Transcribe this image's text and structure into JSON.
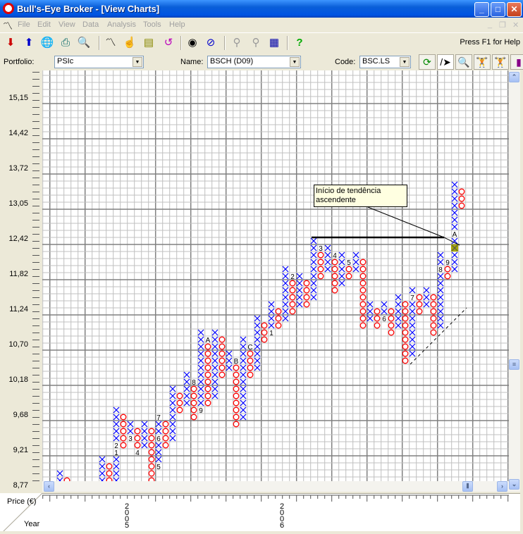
{
  "window": {
    "title": "Bull's-Eye Broker - [View Charts]"
  },
  "menu": [
    "File",
    "Edit",
    "View",
    "Data",
    "Analysis",
    "Tools",
    "Help"
  ],
  "toolbar": {
    "help_text": "Press F1 for Help",
    "icons": [
      "import-icon",
      "export-icon",
      "internet-icon",
      "print-icon",
      "print-preview-icon",
      "chart-icon",
      "pointer-hand-icon",
      "folder-icon",
      "undo-icon",
      "eye-icon",
      "no-icon",
      "zoom-out-icon",
      "zoom-fit-icon",
      "grid-icon",
      "help-icon"
    ]
  },
  "selectors": {
    "portfolio_label": "Portfolio:",
    "portfolio_value": "PSIc",
    "name_label": "Name:",
    "name_value": "BSCH (D09)",
    "code_label": "Code:",
    "code_value": "BSC.LS"
  },
  "annotation": {
    "line1": "Início de tendência",
    "line2": "ascendente"
  },
  "chart_data": {
    "type": "point-and-figure",
    "ylabel": "Price (€)",
    "xlabel": "Year",
    "y_ticks": [
      "15,15",
      "14,42",
      "13,72",
      "13,05",
      "12,42",
      "11,82",
      "11,24",
      "10,70",
      "10,18",
      "9,68",
      "9,21",
      "8,77"
    ],
    "years": [
      "2005",
      "2006"
    ],
    "note": "rows are box indices (5 boxes per labelled tick, 8,77 at box 0)",
    "columns": [
      {
        "col": 2,
        "type": "X",
        "lo": 0,
        "hi": 2
      },
      {
        "col": 3,
        "type": "O",
        "lo": 0,
        "hi": 1
      },
      {
        "col": 8,
        "type": "X",
        "lo": 0,
        "hi": 4
      },
      {
        "col": 9,
        "type": "O",
        "lo": 0,
        "hi": 3
      },
      {
        "col": 10,
        "type": "X",
        "lo": 0,
        "hi": 11,
        "labels": {
          "5": "1",
          "6": "2"
        }
      },
      {
        "col": 11,
        "type": "O",
        "lo": 6,
        "hi": 10
      },
      {
        "col": 12,
        "type": "X",
        "lo": 7,
        "hi": 9,
        "labels": {
          "7": "3"
        }
      },
      {
        "col": 13,
        "type": "O",
        "lo": 5,
        "hi": 8,
        "labels": {
          "5": "4"
        }
      },
      {
        "col": 14,
        "type": "X",
        "lo": 6,
        "hi": 9
      },
      {
        "col": 15,
        "type": "O",
        "lo": 0,
        "hi": 8
      },
      {
        "col": 16,
        "type": "X",
        "lo": 3,
        "hi": 10,
        "labels": {
          "3": "5",
          "7": "6",
          "10": "7"
        }
      },
      {
        "col": 17,
        "type": "O",
        "lo": 6,
        "hi": 9
      },
      {
        "col": 18,
        "type": "X",
        "lo": 7,
        "hi": 14
      },
      {
        "col": 19,
        "type": "O",
        "lo": 11,
        "hi": 13
      },
      {
        "col": 20,
        "type": "X",
        "lo": 12,
        "hi": 16
      },
      {
        "col": 21,
        "type": "O",
        "lo": 10,
        "hi": 15,
        "labels": {
          "15": "8"
        }
      },
      {
        "col": 22,
        "type": "X",
        "lo": 11,
        "hi": 22,
        "labels": {
          "11": "9"
        }
      },
      {
        "col": 23,
        "type": "O",
        "lo": 12,
        "hi": 21,
        "labels": {
          "21": "A"
        }
      },
      {
        "col": 24,
        "type": "X",
        "lo": 13,
        "hi": 22
      },
      {
        "col": 25,
        "type": "O",
        "lo": 16,
        "hi": 21
      },
      {
        "col": 26,
        "type": "X",
        "lo": 17,
        "hi": 19
      },
      {
        "col": 27,
        "type": "O",
        "lo": 9,
        "hi": 18,
        "labels": {
          "18": "B"
        }
      },
      {
        "col": 28,
        "type": "X",
        "lo": 10,
        "hi": 21
      },
      {
        "col": 29,
        "type": "O",
        "lo": 16,
        "hi": 20,
        "labels": {
          "20": "C"
        }
      },
      {
        "col": 30,
        "type": "X",
        "lo": 17,
        "hi": 24
      },
      {
        "col": 31,
        "type": "O",
        "lo": 21,
        "hi": 23
      },
      {
        "col": 32,
        "type": "X",
        "lo": 22,
        "hi": 26,
        "labels": {
          "22": "1"
        }
      },
      {
        "col": 33,
        "type": "O",
        "lo": 23,
        "hi": 25
      },
      {
        "col": 34,
        "type": "X",
        "lo": 24,
        "hi": 31
      },
      {
        "col": 35,
        "type": "O",
        "lo": 25,
        "hi": 30,
        "labels": {
          "30": "2"
        }
      },
      {
        "col": 36,
        "type": "X",
        "lo": 26,
        "hi": 30
      },
      {
        "col": 37,
        "type": "O",
        "lo": 26,
        "hi": 29
      },
      {
        "col": 38,
        "type": "X",
        "lo": 27,
        "hi": 35
      },
      {
        "col": 39,
        "type": "O",
        "lo": 30,
        "hi": 34,
        "labels": {
          "34": "3"
        }
      },
      {
        "col": 40,
        "type": "X",
        "lo": 31,
        "hi": 34
      },
      {
        "col": 41,
        "type": "O",
        "lo": 28,
        "hi": 33,
        "labels": {
          "33": "4"
        }
      },
      {
        "col": 42,
        "type": "X",
        "lo": 29,
        "hi": 33
      },
      {
        "col": 43,
        "type": "O",
        "lo": 30,
        "hi": 32,
        "labels": {
          "32": "5"
        }
      },
      {
        "col": 44,
        "type": "X",
        "lo": 31,
        "hi": 33
      },
      {
        "col": 45,
        "type": "O",
        "lo": 23,
        "hi": 32
      },
      {
        "col": 46,
        "type": "X",
        "lo": 24,
        "hi": 26
      },
      {
        "col": 47,
        "type": "O",
        "lo": 23,
        "hi": 25
      },
      {
        "col": 48,
        "type": "X",
        "lo": 24,
        "hi": 26,
        "labels": {
          "24": "6"
        }
      },
      {
        "col": 49,
        "type": "O",
        "lo": 22,
        "hi": 25
      },
      {
        "col": 50,
        "type": "X",
        "lo": 23,
        "hi": 27
      },
      {
        "col": 51,
        "type": "O",
        "lo": 18,
        "hi": 26
      },
      {
        "col": 52,
        "type": "X",
        "lo": 19,
        "hi": 28,
        "labels": {
          "27": "7"
        }
      },
      {
        "col": 53,
        "type": "O",
        "lo": 25,
        "hi": 27
      },
      {
        "col": 54,
        "type": "X",
        "lo": 26,
        "hi": 28
      },
      {
        "col": 55,
        "type": "O",
        "lo": 22,
        "hi": 27
      },
      {
        "col": 56,
        "type": "X",
        "lo": 23,
        "hi": 33,
        "labels": {
          "31": "8"
        }
      },
      {
        "col": 57,
        "type": "O",
        "lo": 30,
        "hi": 32,
        "labels": {
          "32": "9"
        }
      },
      {
        "col": 58,
        "type": "X",
        "lo": 31,
        "hi": 43,
        "labels": {
          "36": "A"
        },
        "highlight": 34
      },
      {
        "col": 59,
        "type": "O",
        "lo": 40,
        "hi": 42
      }
    ],
    "resistance_line": {
      "from_col": 38,
      "to_col": 57,
      "level_row": 35.5
    },
    "support_line": {
      "from": [
        51.7,
        17.5
      ],
      "to": [
        59.7,
        25.5
      ]
    },
    "colors": {
      "x": "#0000ff",
      "o": "#ff0000",
      "highlight": "#a8a800",
      "grid": "#c0c0c0",
      "grid_major": "#808080"
    }
  }
}
